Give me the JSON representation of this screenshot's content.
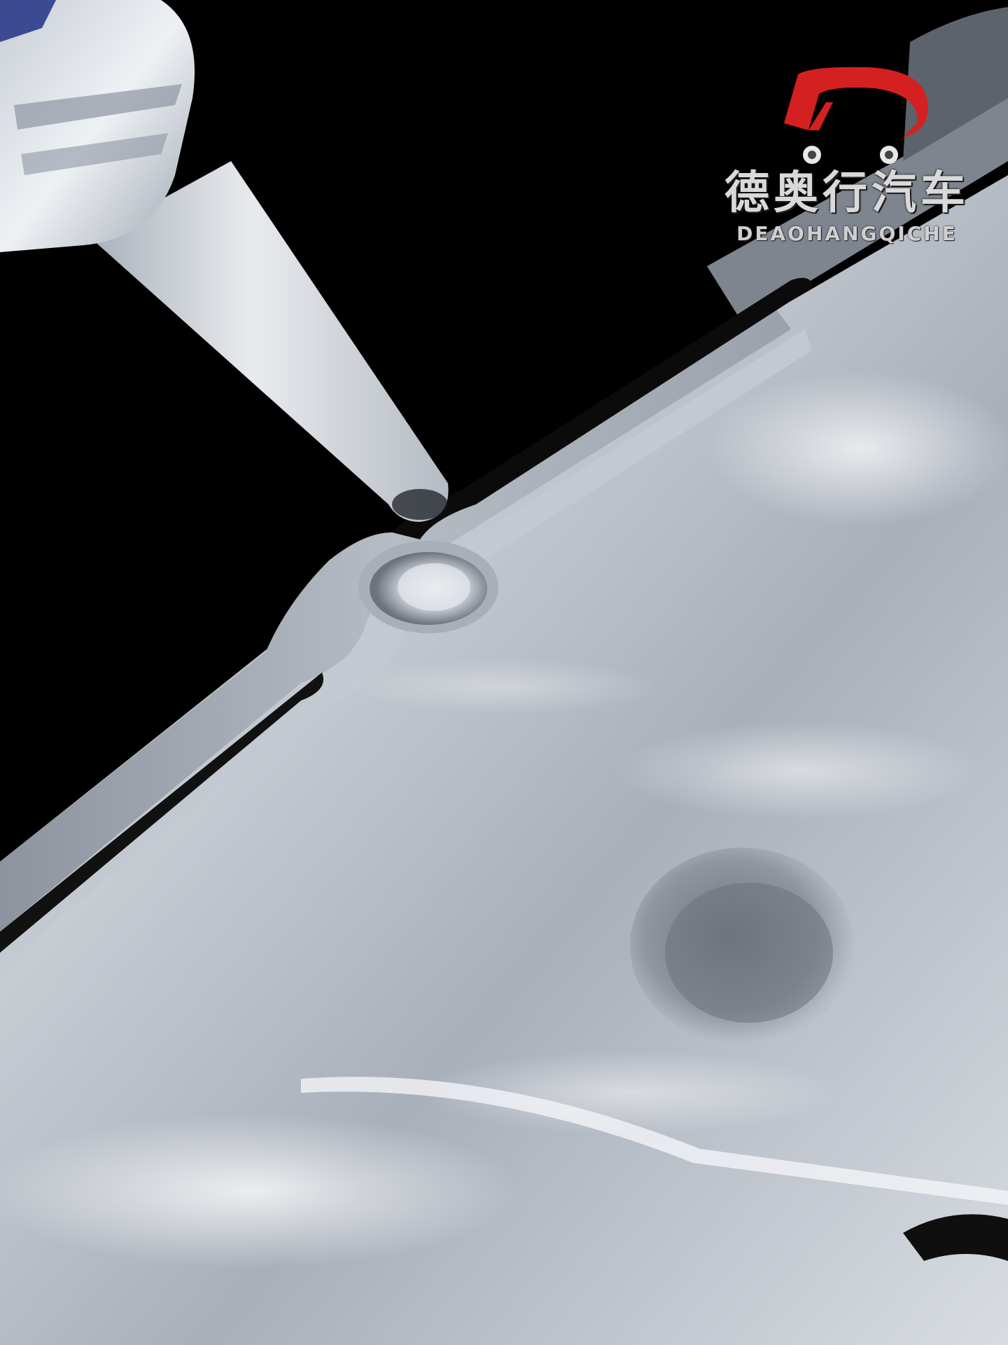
{
  "watermark": {
    "name_cn": "德奥行汽车",
    "name_en": "DEAOHANGQICHE",
    "logo_color": "#d42020"
  },
  "scene": {
    "background_color": "#000000",
    "metal_color": "#c9ced6",
    "nozzle_color": "#d4d9de",
    "sealant_color": "#0a0a0a"
  }
}
